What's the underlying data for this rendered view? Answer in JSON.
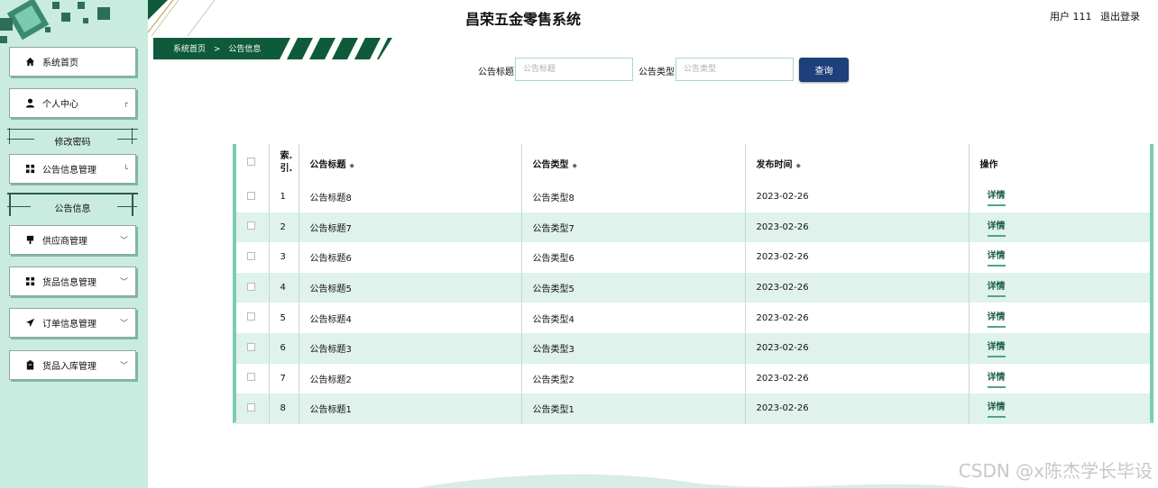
{
  "app": {
    "title": "昌荣五金零售系统"
  },
  "user": {
    "name": "用户 111",
    "logout": "退出登录"
  },
  "breadcrumb": {
    "home": "系统首页",
    "sep": ">",
    "current": "公告信息"
  },
  "sidebar": {
    "items": [
      {
        "label": "系统首页",
        "icon": "home-icon"
      },
      {
        "label": "个人中心",
        "icon": "user-icon"
      },
      {
        "label": "修改密码",
        "icon": ""
      },
      {
        "label": "公告信息管理",
        "icon": "grid-icon"
      },
      {
        "label": "公告信息",
        "icon": ""
      },
      {
        "label": "供应商管理",
        "icon": "supplier-icon"
      },
      {
        "label": "货品信息管理",
        "icon": "grid-icon"
      },
      {
        "label": "订单信息管理",
        "icon": "send-icon"
      },
      {
        "label": "货品入库管理",
        "icon": "clipboard-icon"
      }
    ]
  },
  "search": {
    "title_label": "公告标题",
    "title_placeholder": "公告标题",
    "type_label": "公告类型",
    "type_placeholder": "公告类型",
    "button": "查询"
  },
  "table": {
    "columns": [
      "索引",
      "公告标题",
      "公告类型",
      "发布时间",
      "操作"
    ],
    "index_col_top": "索.",
    "index_col_bottom": "引.",
    "action_label": "详情",
    "rows": [
      {
        "index": "1",
        "title": "公告标题8",
        "type": "公告类型8",
        "date": "2023-02-26"
      },
      {
        "index": "2",
        "title": "公告标题7",
        "type": "公告类型7",
        "date": "2023-02-26"
      },
      {
        "index": "3",
        "title": "公告标题6",
        "type": "公告类型6",
        "date": "2023-02-26"
      },
      {
        "index": "4",
        "title": "公告标题5",
        "type": "公告类型5",
        "date": "2023-02-26"
      },
      {
        "index": "5",
        "title": "公告标题4",
        "type": "公告类型4",
        "date": "2023-02-26"
      },
      {
        "index": "6",
        "title": "公告标题3",
        "type": "公告类型3",
        "date": "2023-02-26"
      },
      {
        "index": "7",
        "title": "公告标题2",
        "type": "公告类型2",
        "date": "2023-02-26"
      },
      {
        "index": "8",
        "title": "公告标题1",
        "type": "公告类型1",
        "date": "2023-02-26"
      }
    ]
  },
  "watermark": "CSDN @x陈杰学长毕设",
  "colors": {
    "sidebar_bg": "#c9ebe0",
    "accent": "#1e3f7a",
    "brand_green": "#0f5a3a",
    "row_alt": "#dff2ec"
  }
}
